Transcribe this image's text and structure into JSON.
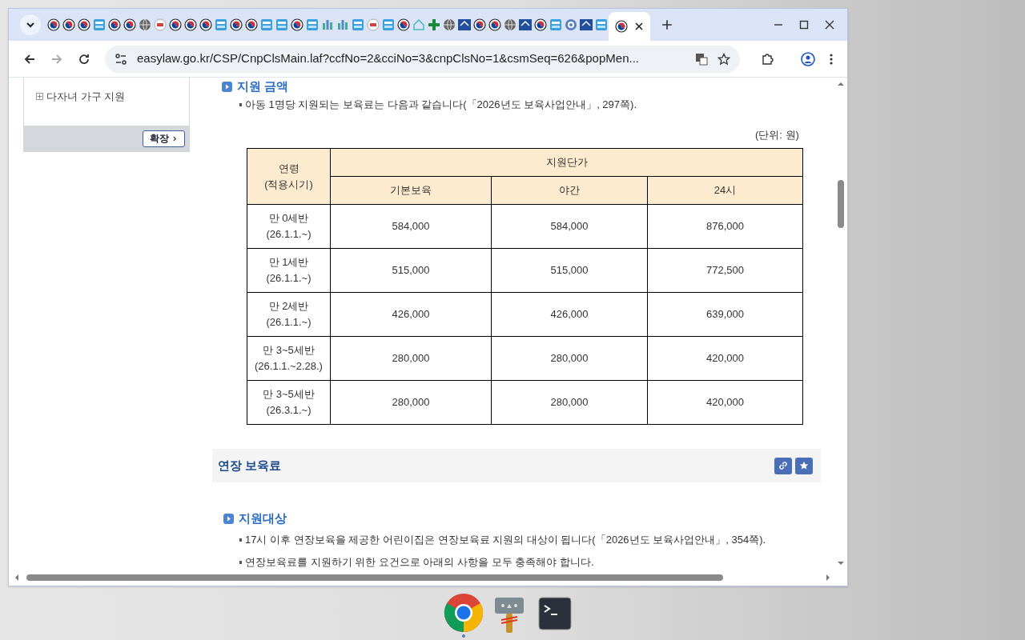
{
  "tabs": [
    {
      "kind": "gov",
      "selected": false
    },
    {
      "kind": "gov",
      "selected": false
    },
    {
      "kind": "gov",
      "selected": false
    },
    {
      "kind": "easy",
      "selected": false
    },
    {
      "kind": "gov",
      "selected": false
    },
    {
      "kind": "gov",
      "selected": false
    },
    {
      "kind": "globe",
      "selected": false
    },
    {
      "kind": "badge",
      "selected": false
    },
    {
      "kind": "gov",
      "selected": false
    },
    {
      "kind": "gov",
      "selected": false
    },
    {
      "kind": "gov",
      "selected": false
    },
    {
      "kind": "easy",
      "selected": false
    },
    {
      "kind": "gov",
      "selected": false
    },
    {
      "kind": "gov",
      "selected": false
    },
    {
      "kind": "easy",
      "selected": false
    },
    {
      "kind": "easy",
      "selected": false
    },
    {
      "kind": "gov",
      "selected": false
    },
    {
      "kind": "easy",
      "selected": false
    },
    {
      "kind": "chart",
      "selected": false
    },
    {
      "kind": "chart",
      "selected": false
    },
    {
      "kind": "easy",
      "selected": false
    },
    {
      "kind": "badge",
      "selected": false
    },
    {
      "kind": "easy",
      "selected": false
    },
    {
      "kind": "gov",
      "selected": false
    },
    {
      "kind": "home",
      "selected": false
    },
    {
      "kind": "plus",
      "selected": false
    },
    {
      "kind": "globe",
      "selected": false
    },
    {
      "kind": "house",
      "selected": false
    },
    {
      "kind": "gov",
      "selected": false
    },
    {
      "kind": "gov",
      "selected": false
    },
    {
      "kind": "globe",
      "selected": false
    },
    {
      "kind": "house",
      "selected": false
    },
    {
      "kind": "gov",
      "selected": false
    },
    {
      "kind": "easy",
      "selected": false
    },
    {
      "kind": "target",
      "selected": false
    },
    {
      "kind": "house",
      "selected": false
    },
    {
      "kind": "easy",
      "selected": false
    },
    {
      "kind": "gov",
      "selected": true
    }
  ],
  "address_bar": {
    "url": "easylaw.go.kr/CSP/CnpClsMain.laf?ccfNo=2&cciNo=3&cnpClsNo=1&csmSeq=626&popMen..."
  },
  "sidebar": {
    "items": [
      {
        "label": "다자녀 가구 지원",
        "expanded": false
      }
    ],
    "expand_button": "확장"
  },
  "section1": {
    "heading": "지원 금액",
    "bullet": "아동 1명당 지원되는 보육료는 다음과 같습니다(「2026년도 보육사업안내」, 297쪽).",
    "unit": "(단위: 원)",
    "table": {
      "age_header": [
        "연령",
        "(적용시기)"
      ],
      "group_header": "지원단가",
      "columns": [
        "기본보육",
        "야간",
        "24시"
      ],
      "rows": [
        {
          "age": [
            "만 0세반",
            "(26.1.1.~)"
          ],
          "cells": [
            "584,000",
            "584,000",
            "876,000"
          ]
        },
        {
          "age": [
            "만 1세반",
            "(26.1.1.~)"
          ],
          "cells": [
            "515,000",
            "515,000",
            "772,500"
          ]
        },
        {
          "age": [
            "만 2세반",
            "(26.1.1.~)"
          ],
          "cells": [
            "426,000",
            "426,000",
            "639,000"
          ]
        },
        {
          "age": [
            "만 3~5세반",
            "(26.1.1.~2.28.)"
          ],
          "cells": [
            "280,000",
            "280,000",
            "420,000"
          ]
        },
        {
          "age": [
            "만 3~5세반",
            "(26.3.1.~)"
          ],
          "cells": [
            "280,000",
            "280,000",
            "420,000"
          ]
        }
      ]
    }
  },
  "section2": {
    "title": "연장 보육료",
    "heading": "지원대상",
    "bullets": [
      "17시 이후 연장보육을 제공한 어린이집은 연장보육료 지원의 대상이 됩니다(「2026년도 보육사업안내」, 354쪽).",
      "연장보육료를 지원하기 위한 요건으로 아래의 사항을 모두 충족해야 합니다."
    ]
  }
}
